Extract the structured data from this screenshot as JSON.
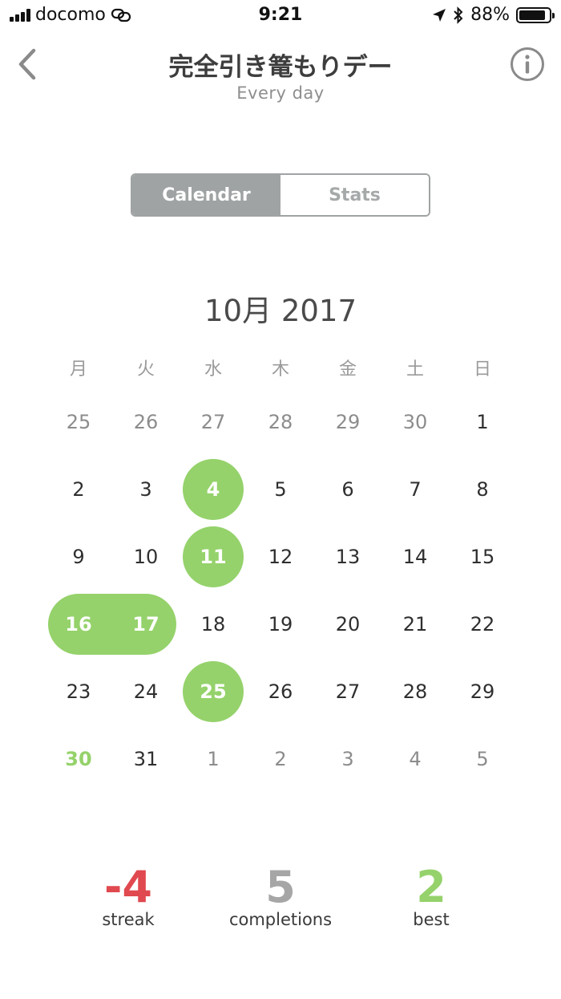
{
  "status_bar": {
    "carrier": "docomo",
    "time": "9:21",
    "battery_percent": "88%",
    "battery_level": 0.88
  },
  "header": {
    "title": "完全引き篭もりデー",
    "subtitle": "Every day",
    "back_icon": "chevron-left-icon",
    "info_icon": "info-circle-icon"
  },
  "tabs": {
    "calendar_label": "Calendar",
    "stats_label": "Stats",
    "active": "calendar"
  },
  "calendar": {
    "month_title": "10月 2017",
    "weekdays": [
      "月",
      "火",
      "水",
      "木",
      "金",
      "土",
      "日"
    ],
    "weeks": [
      [
        {
          "label": "25",
          "state": "outside"
        },
        {
          "label": "26",
          "state": "outside"
        },
        {
          "label": "27",
          "state": "outside"
        },
        {
          "label": "28",
          "state": "outside"
        },
        {
          "label": "29",
          "state": "outside"
        },
        {
          "label": "30",
          "state": "outside"
        },
        {
          "label": "1",
          "state": "normal"
        }
      ],
      [
        {
          "label": "2",
          "state": "normal"
        },
        {
          "label": "3",
          "state": "normal"
        },
        {
          "label": "4",
          "state": "done"
        },
        {
          "label": "5",
          "state": "normal"
        },
        {
          "label": "6",
          "state": "normal"
        },
        {
          "label": "7",
          "state": "normal"
        },
        {
          "label": "8",
          "state": "normal"
        }
      ],
      [
        {
          "label": "9",
          "state": "normal"
        },
        {
          "label": "10",
          "state": "normal"
        },
        {
          "label": "11",
          "state": "done"
        },
        {
          "label": "12",
          "state": "normal"
        },
        {
          "label": "13",
          "state": "normal"
        },
        {
          "label": "14",
          "state": "normal"
        },
        {
          "label": "15",
          "state": "normal"
        }
      ],
      [
        {
          "label": "16",
          "state": "done-streak"
        },
        {
          "label": "17",
          "state": "done-streak"
        },
        {
          "label": "18",
          "state": "normal"
        },
        {
          "label": "19",
          "state": "normal"
        },
        {
          "label": "20",
          "state": "normal"
        },
        {
          "label": "21",
          "state": "normal"
        },
        {
          "label": "22",
          "state": "normal"
        }
      ],
      [
        {
          "label": "23",
          "state": "normal"
        },
        {
          "label": "24",
          "state": "normal"
        },
        {
          "label": "25",
          "state": "done"
        },
        {
          "label": "26",
          "state": "normal"
        },
        {
          "label": "27",
          "state": "normal"
        },
        {
          "label": "28",
          "state": "normal"
        },
        {
          "label": "29",
          "state": "normal"
        }
      ],
      [
        {
          "label": "30",
          "state": "today"
        },
        {
          "label": "31",
          "state": "normal"
        },
        {
          "label": "1",
          "state": "outside"
        },
        {
          "label": "2",
          "state": "outside"
        },
        {
          "label": "3",
          "state": "outside"
        },
        {
          "label": "4",
          "state": "outside"
        },
        {
          "label": "5",
          "state": "outside"
        }
      ]
    ]
  },
  "stats": {
    "streak_value": "-4",
    "streak_label": "streak",
    "completions_value": "5",
    "completions_label": "completions",
    "best_value": "2",
    "best_label": "best"
  },
  "colors": {
    "accent_green": "#95d26b",
    "streak_red": "#e0494f",
    "completions_gray": "#a6a6a6",
    "segment_gray": "#a0a3a4"
  }
}
